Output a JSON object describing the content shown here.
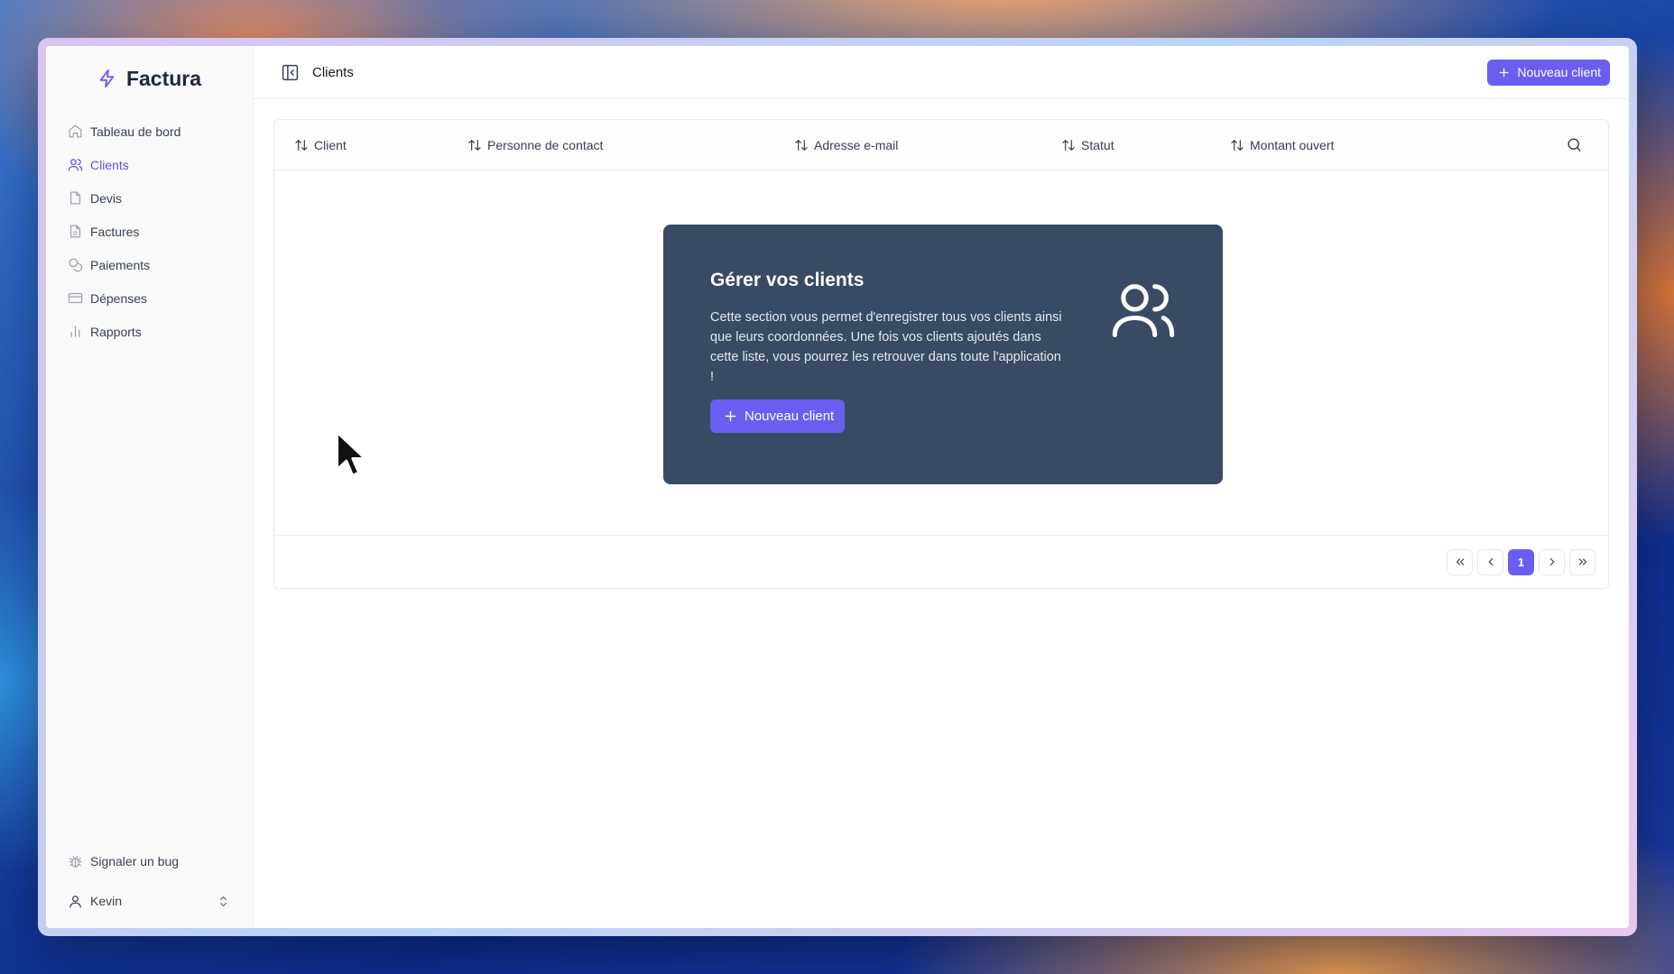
{
  "brand": {
    "name": "Factura",
    "icon": "bolt-icon",
    "accent": "#6a5ef0"
  },
  "sidebar": {
    "items": [
      {
        "label": "Tableau de bord",
        "icon": "home-icon",
        "active": false
      },
      {
        "label": "Clients",
        "icon": "users-icon",
        "active": true
      },
      {
        "label": "Devis",
        "icon": "file-icon",
        "active": false
      },
      {
        "label": "Factures",
        "icon": "file-text-icon",
        "active": false
      },
      {
        "label": "Paiements",
        "icon": "coins-icon",
        "active": false
      },
      {
        "label": "Dépenses",
        "icon": "credit-card-icon",
        "active": false
      },
      {
        "label": "Rapports",
        "icon": "bar-chart-icon",
        "active": false
      }
    ],
    "report_bug": "Signaler un bug",
    "user_name": "Kevin"
  },
  "header": {
    "title": "Clients",
    "new_client_label": "Nouveau client"
  },
  "table": {
    "columns": [
      "Client",
      "Personne de contact",
      "Adresse e-mail",
      "Statut",
      "Montant ouvert"
    ]
  },
  "empty_state": {
    "title": "Gérer vos clients",
    "description": "Cette section vous permet d'enregistrer tous vos clients ainsi que leurs coordonnées. Une fois vos clients ajoutés dans cette liste, vous pourrez les retrouver dans toute l'application !",
    "button_label": "Nouveau client",
    "icon": "users-icon",
    "background": "#394a64"
  },
  "pagination": {
    "current_page": "1"
  }
}
